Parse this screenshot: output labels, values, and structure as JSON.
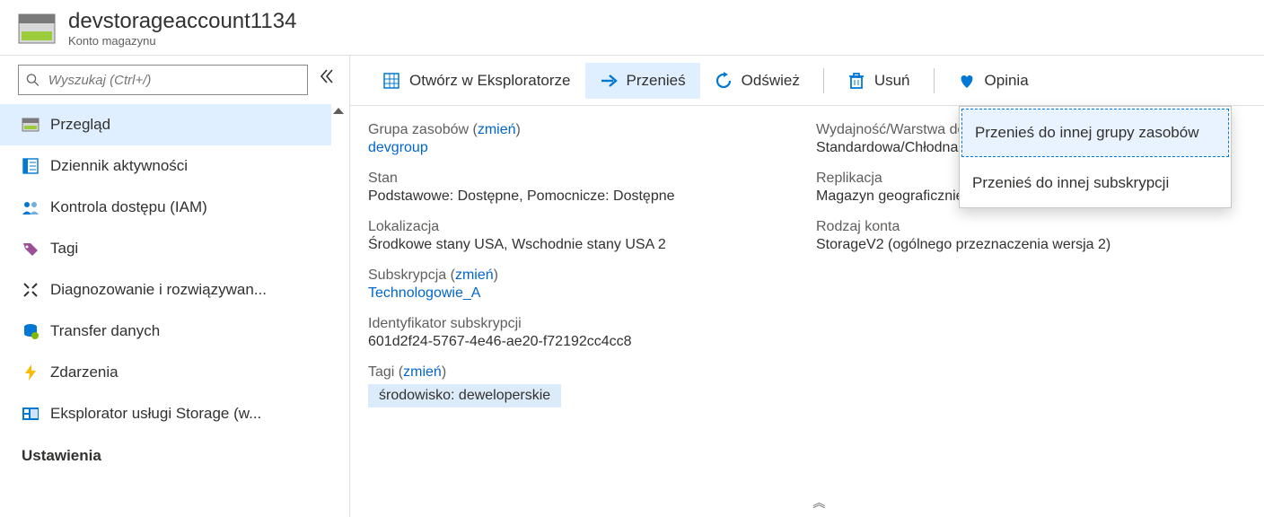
{
  "header": {
    "title": "devstorageaccount1134",
    "subtitle": "Konto magazynu"
  },
  "search": {
    "placeholder": "Wyszukaj (Ctrl+/)"
  },
  "sidebar": {
    "items": [
      {
        "label": "Przegląd"
      },
      {
        "label": "Dziennik aktywności"
      },
      {
        "label": "Kontrola dostępu (IAM)"
      },
      {
        "label": "Tagi"
      },
      {
        "label": "Diagnozowanie i rozwiązywan..."
      },
      {
        "label": "Transfer danych"
      },
      {
        "label": "Zdarzenia"
      },
      {
        "label": "Eksplorator usługi Storage (w..."
      }
    ],
    "section": "Ustawienia"
  },
  "toolbar": {
    "open_label": "Otwórz w Eksploratorze",
    "move_label": "Przenieś",
    "refresh_label": "Odśwież",
    "delete_label": "Usuń",
    "feedback_label": "Opinia"
  },
  "move_menu": {
    "to_rg": "Przenieś do innej grupy zasobów",
    "to_sub": "Przenieś do innej subskrypcji"
  },
  "details": {
    "left": {
      "rg_label": "Grupa zasobów",
      "rg_change": "zmień",
      "rg_value": "devgroup",
      "status_label": "Stan",
      "status_value": "Podstawowe: Dostępne, Pomocnicze: Dostępne",
      "loc_label": "Lokalizacja",
      "loc_value": "Środkowe stany USA, Wschodnie stany USA 2",
      "sub_label": "Subskrypcja",
      "sub_change": "zmień",
      "sub_value": "Technologowie_A",
      "subid_label": "Identyfikator subskrypcji",
      "subid_value": "601d2f24-5767-4e46-ae20-f72192cc4cc8",
      "tags_label": "Tagi",
      "tags_change": "zmień",
      "tag_chip": "środowisko: deweloperskie"
    },
    "right": {
      "perf_label": "Wydajność/Warstwa dostępu",
      "perf_value": "Standardowa/Chłodna",
      "repl_label": "Replikacja",
      "repl_value": "Magazyn geograficznie nadmiarowy dostęp...",
      "kind_label": "Rodzaj konta",
      "kind_value": "StorageV2 (ogólnego przeznaczenia wersja 2)"
    }
  }
}
